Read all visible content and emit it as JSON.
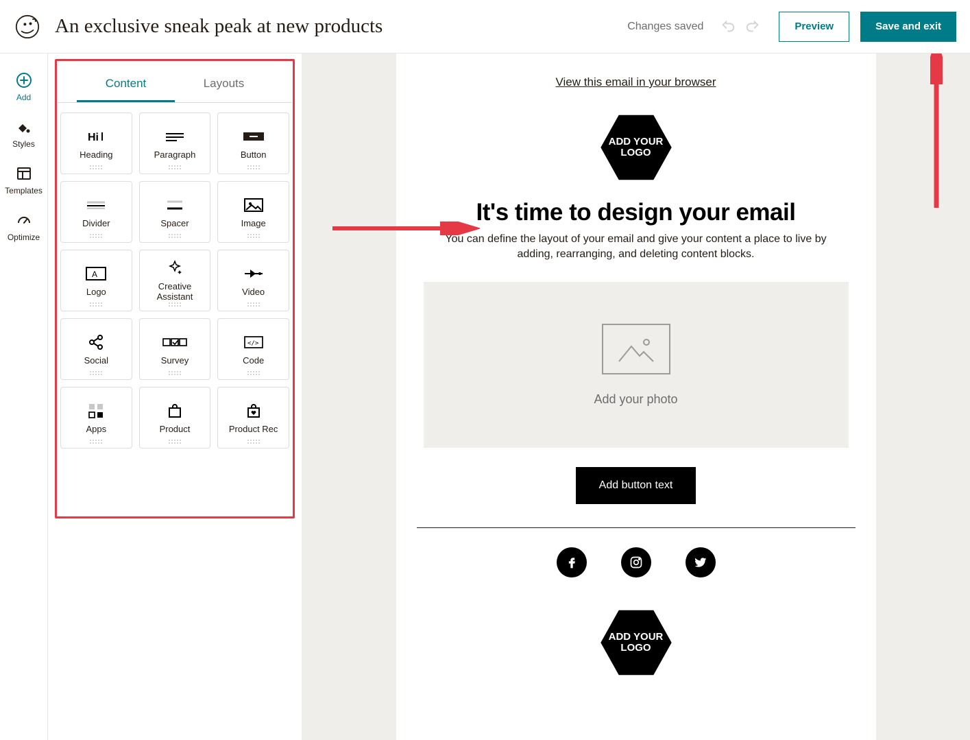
{
  "header": {
    "title": "An exclusive sneak peak at new products",
    "status": "Changes saved",
    "preview": "Preview",
    "save": "Save and exit"
  },
  "rail": {
    "items": [
      {
        "label": "Add",
        "icon": "plus-circle",
        "active": true
      },
      {
        "label": "Styles",
        "icon": "paint"
      },
      {
        "label": "Templates",
        "icon": "template"
      },
      {
        "label": "Optimize",
        "icon": "gauge"
      }
    ]
  },
  "panel": {
    "tabs": [
      {
        "label": "Content",
        "active": true
      },
      {
        "label": "Layouts",
        "active": false
      }
    ],
    "blocks": [
      {
        "label": "Heading",
        "icon": "hi"
      },
      {
        "label": "Paragraph",
        "icon": "paragraph"
      },
      {
        "label": "Button",
        "icon": "button"
      },
      {
        "label": "Divider",
        "icon": "divider"
      },
      {
        "label": "Spacer",
        "icon": "spacer"
      },
      {
        "label": "Image",
        "icon": "image"
      },
      {
        "label": "Logo",
        "icon": "logo"
      },
      {
        "label": "Creative Assistant",
        "icon": "sparkle"
      },
      {
        "label": "Video",
        "icon": "video"
      },
      {
        "label": "Social",
        "icon": "share"
      },
      {
        "label": "Survey",
        "icon": "survey"
      },
      {
        "label": "Code",
        "icon": "code"
      },
      {
        "label": "Apps",
        "icon": "apps"
      },
      {
        "label": "Product",
        "icon": "bag"
      },
      {
        "label": "Product Rec",
        "icon": "bag-heart"
      }
    ]
  },
  "email": {
    "view_link": "View this email in your browser",
    "logo_text": "ADD YOUR LOGO",
    "heading": "It's time to design your email",
    "subheading": "You can define the layout of your email and give your content a place to live by adding, rearranging, and deleting content blocks.",
    "photo_label": "Add your photo",
    "cta": "Add button text"
  },
  "colors": {
    "accent": "#007c89",
    "highlight": "#e63946"
  }
}
